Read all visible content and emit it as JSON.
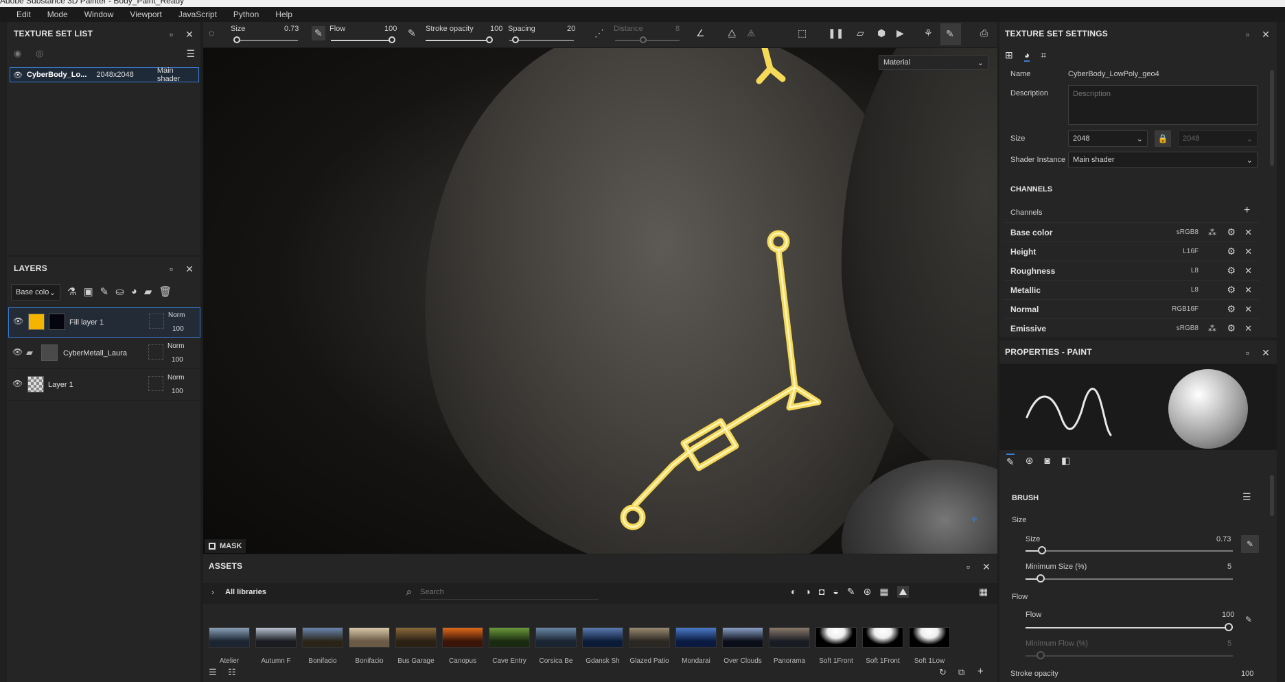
{
  "window": {
    "title": "Adobe Substance 3D Painter - Body_Paint_Ready"
  },
  "menu": [
    "Edit",
    "Mode",
    "Window",
    "Viewport",
    "JavaScript",
    "Python",
    "Help"
  ],
  "toolbar": {
    "size_label": "Size",
    "size_value": "0.73",
    "flow_label": "Flow",
    "flow_value": "100",
    "stroke_opacity_label": "Stroke opacity",
    "stroke_opacity_value": "100",
    "spacing_label": "Spacing",
    "spacing_value": "20",
    "distance_label": "Distance",
    "distance_value": "8"
  },
  "texture_set_list": {
    "title": "TEXTURE SET LIST",
    "row": {
      "name": "CyberBody_Lo...",
      "size": "2048x2048",
      "shader": "Main shader"
    }
  },
  "layers": {
    "title": "LAYERS",
    "channel_select": "Base colo",
    "items": [
      {
        "name": "Fill layer 1",
        "blend": "Norm",
        "opacity": "100"
      },
      {
        "name": "CyberMetall_Laura",
        "blend": "Norm",
        "opacity": "100"
      },
      {
        "name": "Layer 1",
        "blend": "Norm",
        "opacity": "100"
      }
    ]
  },
  "viewport": {
    "mode_select": "Material",
    "mask_label": "MASK"
  },
  "assets": {
    "title": "ASSETS",
    "libraries_label": "All libraries",
    "search_placeholder": "Search",
    "thumbs": [
      "Atelier",
      "Autumn F",
      "Bonifacio",
      "Bonifacio",
      "Bus Garage",
      "Canopus",
      "Cave Entry",
      "Corsica Be",
      "Gdansk Sh",
      "Glazed Patio",
      "Mondarai",
      "Over Clouds",
      "Panorama",
      "Soft 1Front",
      "Soft 1Front",
      "Soft 1Low"
    ]
  },
  "texture_set_settings": {
    "title": "TEXTURE SET SETTINGS",
    "name_label": "Name",
    "name_value": "CyberBody_LowPoly_geo4",
    "description_label": "Description",
    "description_placeholder": "Description",
    "size_label": "Size",
    "size_value": "2048",
    "size_locked_value": "2048",
    "shader_label": "Shader Instance",
    "shader_value": "Main shader",
    "channels_title": "CHANNELS",
    "channels_label": "Channels",
    "channels": [
      {
        "name": "Base color",
        "format": "sRGB8"
      },
      {
        "name": "Height",
        "format": "L16F"
      },
      {
        "name": "Roughness",
        "format": "L8"
      },
      {
        "name": "Metallic",
        "format": "L8"
      },
      {
        "name": "Normal",
        "format": "RGB16F"
      },
      {
        "name": "Emissive",
        "format": "sRGB8"
      }
    ]
  },
  "properties": {
    "title": "PROPERTIES - PAINT",
    "brush_title": "BRUSH",
    "size_group": "Size",
    "size_label": "Size",
    "size_value": "0.73",
    "min_size_label": "Minimum Size (%)",
    "min_size_value": "5",
    "flow_group": "Flow",
    "flow_label": "Flow",
    "flow_value": "100",
    "min_flow_label": "Minimum Flow (%)",
    "min_flow_value": "5",
    "stroke_opacity_label": "Stroke opacity",
    "stroke_opacity_value": "100"
  },
  "colors": {
    "accent": "#3a7bd5",
    "glow": "#ffd23a",
    "fill_swatch": "#f5b400"
  }
}
